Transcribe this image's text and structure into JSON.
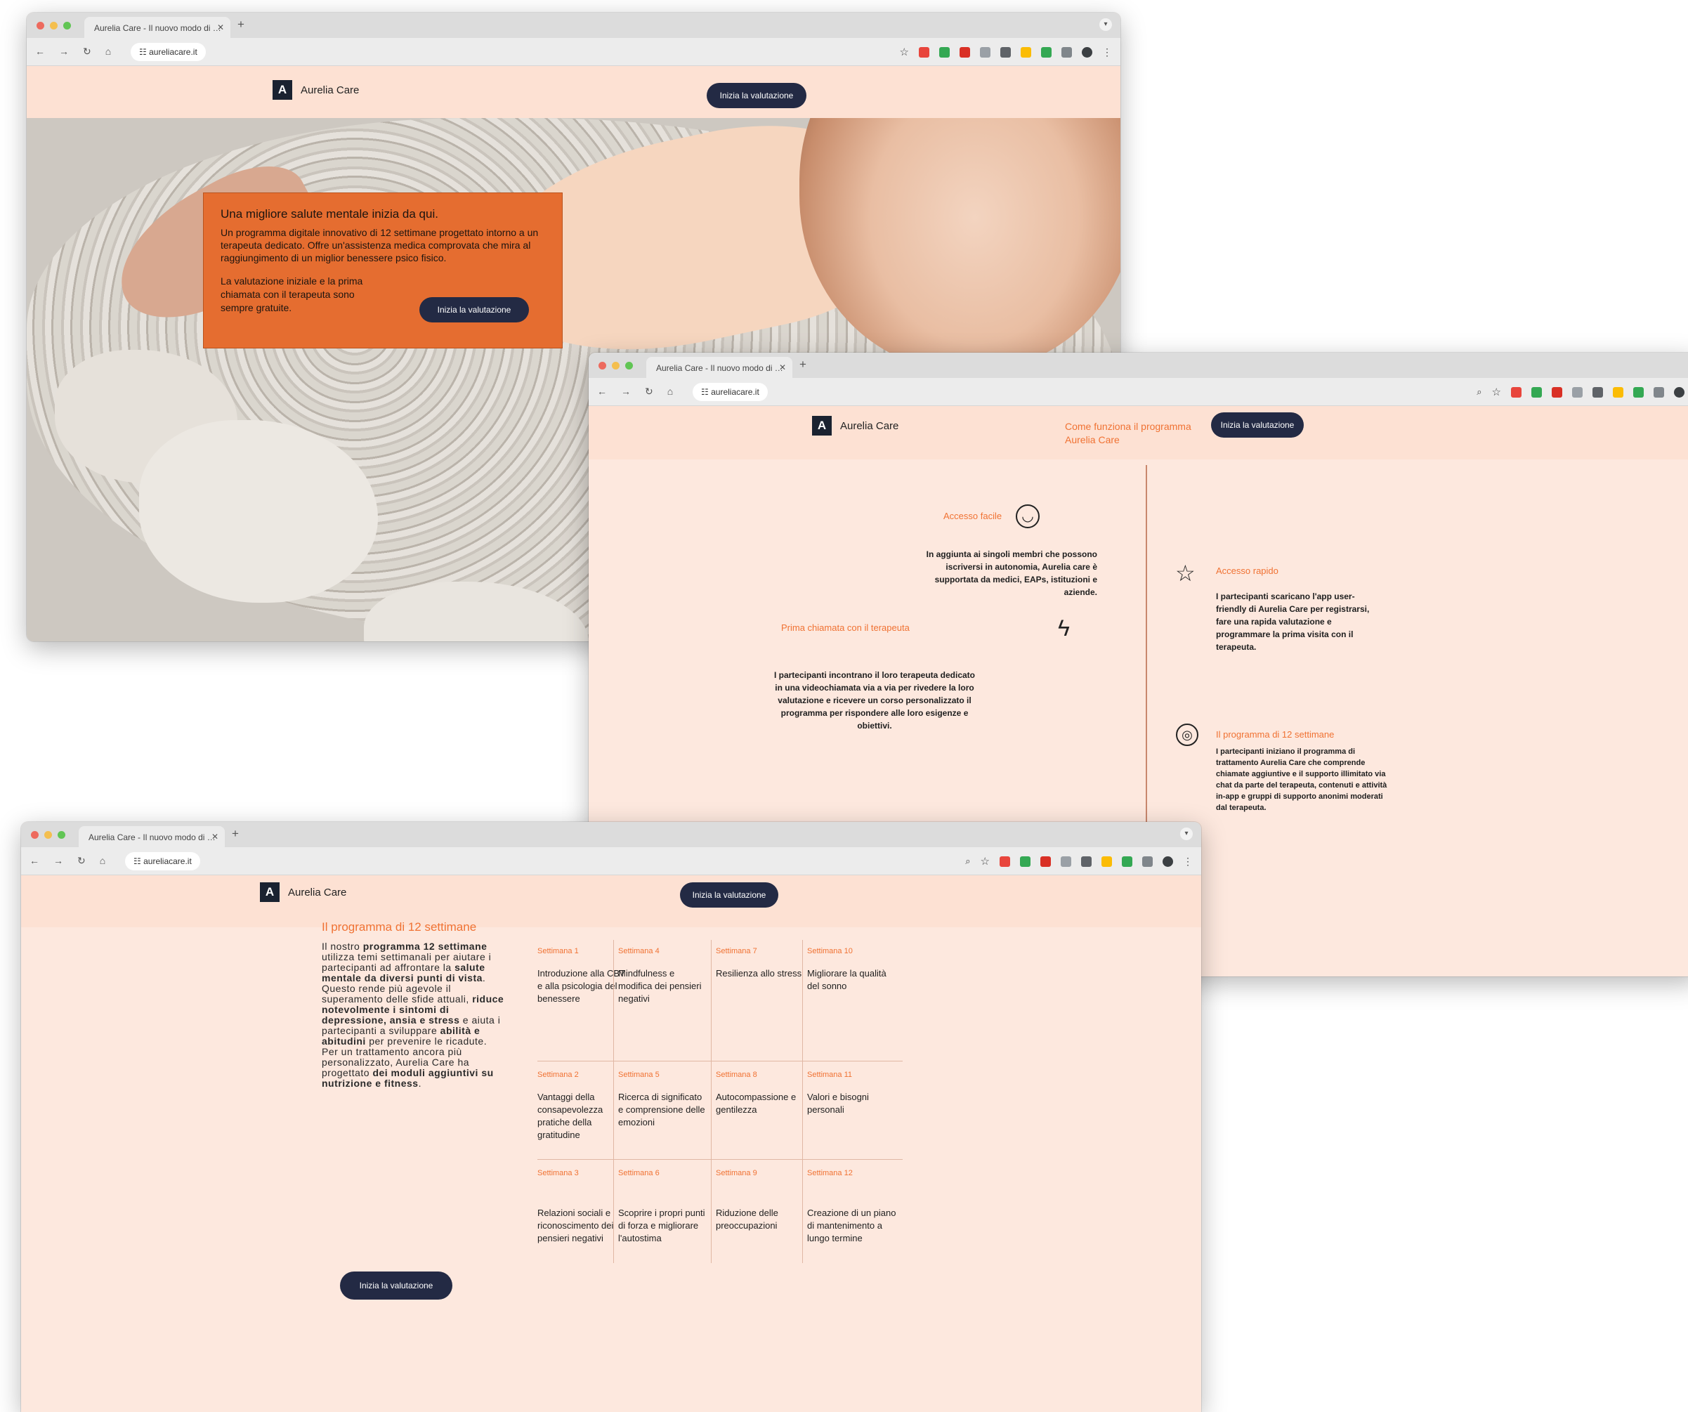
{
  "colors": {
    "brand_navy": "#232a44",
    "accent_orange": "#f07233",
    "card_orange": "#e56d30",
    "page_bg": "#fde8de"
  },
  "browser": {
    "tab_title": "Aurelia Care - Il nuovo modo di …",
    "new_tab_icon": "plus-icon",
    "url": "aureliacare.it"
  },
  "brand": {
    "name": "Aurelia Care",
    "logo_icon": "a-logo-mark"
  },
  "cta": {
    "label": "Inizia la valutazione"
  },
  "hero": {
    "heading": "Una migliore salute mentale inizia da qui.",
    "body": "Un programma digitale innovativo di 12 settimane progettato intorno a un terapeuta dedicato. Offre un'assistenza medica comprovata che mira al raggiungimento di un miglior benessere psico fisico.",
    "free_note": "La valutazione iniziale e la prima chiamata con il terapeuta sono sempre gratuite."
  },
  "how": {
    "title": "Come funziona il programma Aurelia Care",
    "features": [
      {
        "title": "Accesso facile",
        "icon": "smile-icon",
        "body": "In aggiunta ai singoli membri che possono iscriversi in autonomia, Aurelia care è supportata da medici, EAPs, istituzioni e aziende."
      },
      {
        "title": "Accesso rapido",
        "icon": "star-icon",
        "body": "I partecipanti scaricano l'app user-friendly di Aurelia Care per registrarsi, fare una rapida valutazione e programmare la prima visita con il terapeuta."
      },
      {
        "title": "Prima chiamata con il terapeuta",
        "icon": "lightning-icon",
        "body": "I partecipanti incontrano il loro terapeuta dedicato in una videochiamata via a via per rivedere la loro valutazione e ricevere un corso personalizzato il programma per rispondere alle loro esigenze e obiettivi."
      },
      {
        "title": "Il programma di 12 settimane",
        "icon": "target-icon",
        "body": "I partecipanti iniziano il programma di trattamento Aurelia Care che comprende chiamate aggiuntive e il supporto illimitato via chat da parte del terapeuta, contenuti e attività in-app e gruppi di supporto anonimi moderati dal terapeuta."
      }
    ]
  },
  "program": {
    "title": "Il programma di 12 settimane",
    "intro_html": "Il nostro <b>programma 12 settimane</b> utilizza temi settimanali per aiutare i partecipanti ad affrontare la <b>salute mentale da diversi punti di vista</b>.<br>Questo rende più agevole il superamento delle sfide attuali, <b>riduce notevolmente i sintomi di depressione, ansia e stress</b> e aiuta i partecipanti a sviluppare <b>abilità e abitudini</b> per prevenire le ricadute.<br>Per un trattamento ancora più personalizzato, Aurelia Care ha progettato <b>dei moduli aggiuntivi su nutrizione e fitness</b>.",
    "weeks": [
      {
        "label": "Settimana 1",
        "topic": "Introduzione alla CBT e alla psicologia del benessere"
      },
      {
        "label": "Settimana 4",
        "topic": "Mindfulness e modifica dei pensieri negativi"
      },
      {
        "label": "Settimana 7",
        "topic": "Resilienza allo stress"
      },
      {
        "label": "Settimana 10",
        "topic": "Migliorare la qualità del sonno"
      },
      {
        "label": "Settimana 2",
        "topic": "Vantaggi della consapevolezza pratiche della gratitudine"
      },
      {
        "label": "Settimana 5",
        "topic": "Ricerca di significato e comprensione delle emozioni"
      },
      {
        "label": "Settimana 8",
        "topic": "Autocompassione e gentilezza"
      },
      {
        "label": "Settimana 11",
        "topic": "Valori e bisogni personali"
      },
      {
        "label": "Settimana 3",
        "topic": "Relazioni sociali e riconoscimento dei pensieri negativi"
      },
      {
        "label": "Settimana 6",
        "topic": "Scoprire i propri punti di forza e migliorare l'autostima"
      },
      {
        "label": "Settimana 9",
        "topic": "Riduzione delle preoccupazioni"
      },
      {
        "label": "Settimana 12",
        "topic": "Creazione di un piano di mantenimento a lungo termine"
      }
    ]
  }
}
